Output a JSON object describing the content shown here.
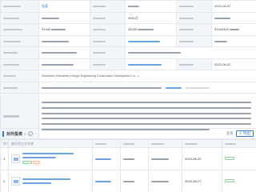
{
  "basic_info": {
    "rows": [
      {
        "cells": [
          {
            "type": "label"
          },
          {
            "type": "value-link",
            "text": "张某"
          },
          {
            "type": "label"
          },
          {
            "type": "value"
          },
          {
            "type": "label"
          },
          {
            "type": "value-text",
            "text": "2023-06-02"
          }
        ]
      },
      {
        "cells": [
          {
            "type": "label"
          },
          {
            "type": "value"
          },
          {
            "type": "label"
          },
          {
            "type": "value-text",
            "text": "3000万"
          },
          {
            "type": "label"
          },
          {
            "type": "value"
          }
        ]
      },
      {
        "cells": [
          {
            "type": "label"
          },
          {
            "type": "value-text",
            "text": "91440"
          },
          {
            "type": "label"
          },
          {
            "type": "value-text",
            "text": "44030"
          },
          {
            "type": "label"
          },
          {
            "type": "value-text",
            "text": "91440300"
          }
        ]
      },
      {
        "cells": [
          {
            "type": "label"
          },
          {
            "type": "value"
          },
          {
            "type": "label"
          },
          {
            "type": "value-link"
          },
          {
            "type": "label"
          },
          {
            "type": "value"
          }
        ]
      },
      {
        "cells": [
          {
            "type": "label"
          },
          {
            "type": "value"
          },
          {
            "type": "label"
          },
          {
            "type": "value-wide"
          }
        ]
      },
      {
        "cells": [
          {
            "type": "label"
          },
          {
            "type": "value"
          },
          {
            "type": "label"
          },
          {
            "type": "value-link"
          },
          {
            "type": "label"
          },
          {
            "type": "value-text",
            "text": "2023-06-02"
          }
        ]
      }
    ],
    "english_name": "Zhenshen (Shenzhen) Hongxi Engineering Construction Development Co., L...",
    "scope_lines": 6
  },
  "subsection": {
    "title": "对外投资",
    "count": "2",
    "right_label": "查看",
    "export_label": "导出",
    "columns": [
      "序号",
      "被投资企业名称",
      "",
      "",
      "",
      "",
      ""
    ],
    "rows": [
      {
        "index": "1",
        "date": "2023-06-22"
      },
      {
        "index": "2",
        "date": "2023-06-27"
      }
    ]
  },
  "colors": {
    "accent": "#2e7bd6",
    "label_bg": "#f2f6fa",
    "border": "#e4e8ee"
  }
}
